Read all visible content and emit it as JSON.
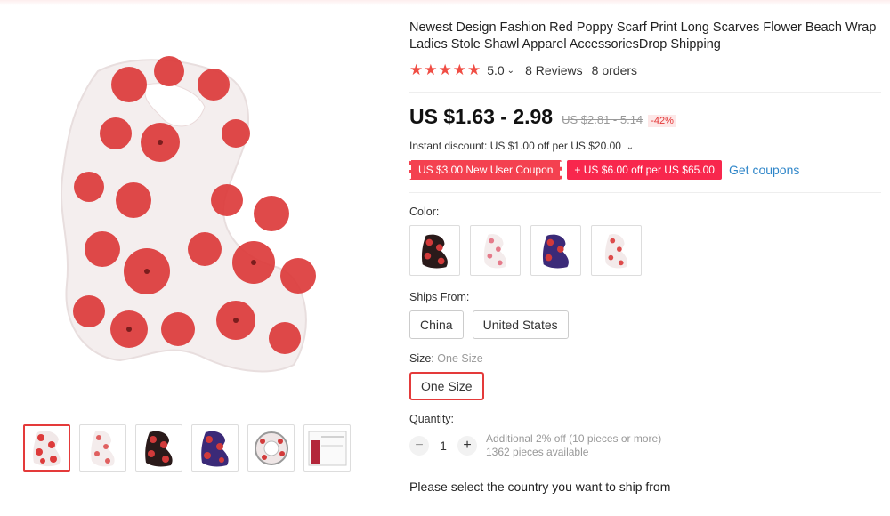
{
  "product": {
    "title": "Newest Design Fashion Red Poppy Scarf Print Long Scarves Flower Beach Wrap Ladies Stole Shawl Apparel AccessoriesDrop Shipping",
    "stars": "★★★★★",
    "rating": "5.0",
    "reviews": "8 Reviews",
    "orders": "8 orders",
    "price": "US $1.63 - 2.98",
    "original_price": "US $2.81 - 5.14",
    "discount": "-42%",
    "instant_discount": "Instant discount: US $1.00 off per US $20.00",
    "coupons": [
      "US $3.00 New User Coupon",
      "+ US $6.00 off per US $65.00"
    ],
    "get_coupons": "Get coupons"
  },
  "colors": {
    "brand_red": "#e43a3a",
    "coupon_red": "#f44150",
    "link_blue": "#2f86c9"
  },
  "gallery": {
    "thumbnails": [
      "white-red-poppy",
      "white-red-poppy-2",
      "black-red-poppy",
      "purple-red-poppy",
      "rolled-scarf",
      "size-chart"
    ]
  },
  "options": {
    "color_label": "Color:",
    "color_swatches": [
      "black",
      "white-pink",
      "purple",
      "white-red"
    ],
    "ships_from_label": "Ships From:",
    "ships_from": [
      "China",
      "United States"
    ],
    "size_label": "Size:",
    "size_value": "One Size",
    "sizes": [
      "One Size"
    ],
    "quantity_label": "Quantity:",
    "quantity": "1",
    "quantity_note1": "Additional 2% off (10 pieces or more)",
    "quantity_note2": "1362 pieces available",
    "ship_prompt": "Please select the country you want to ship from"
  }
}
